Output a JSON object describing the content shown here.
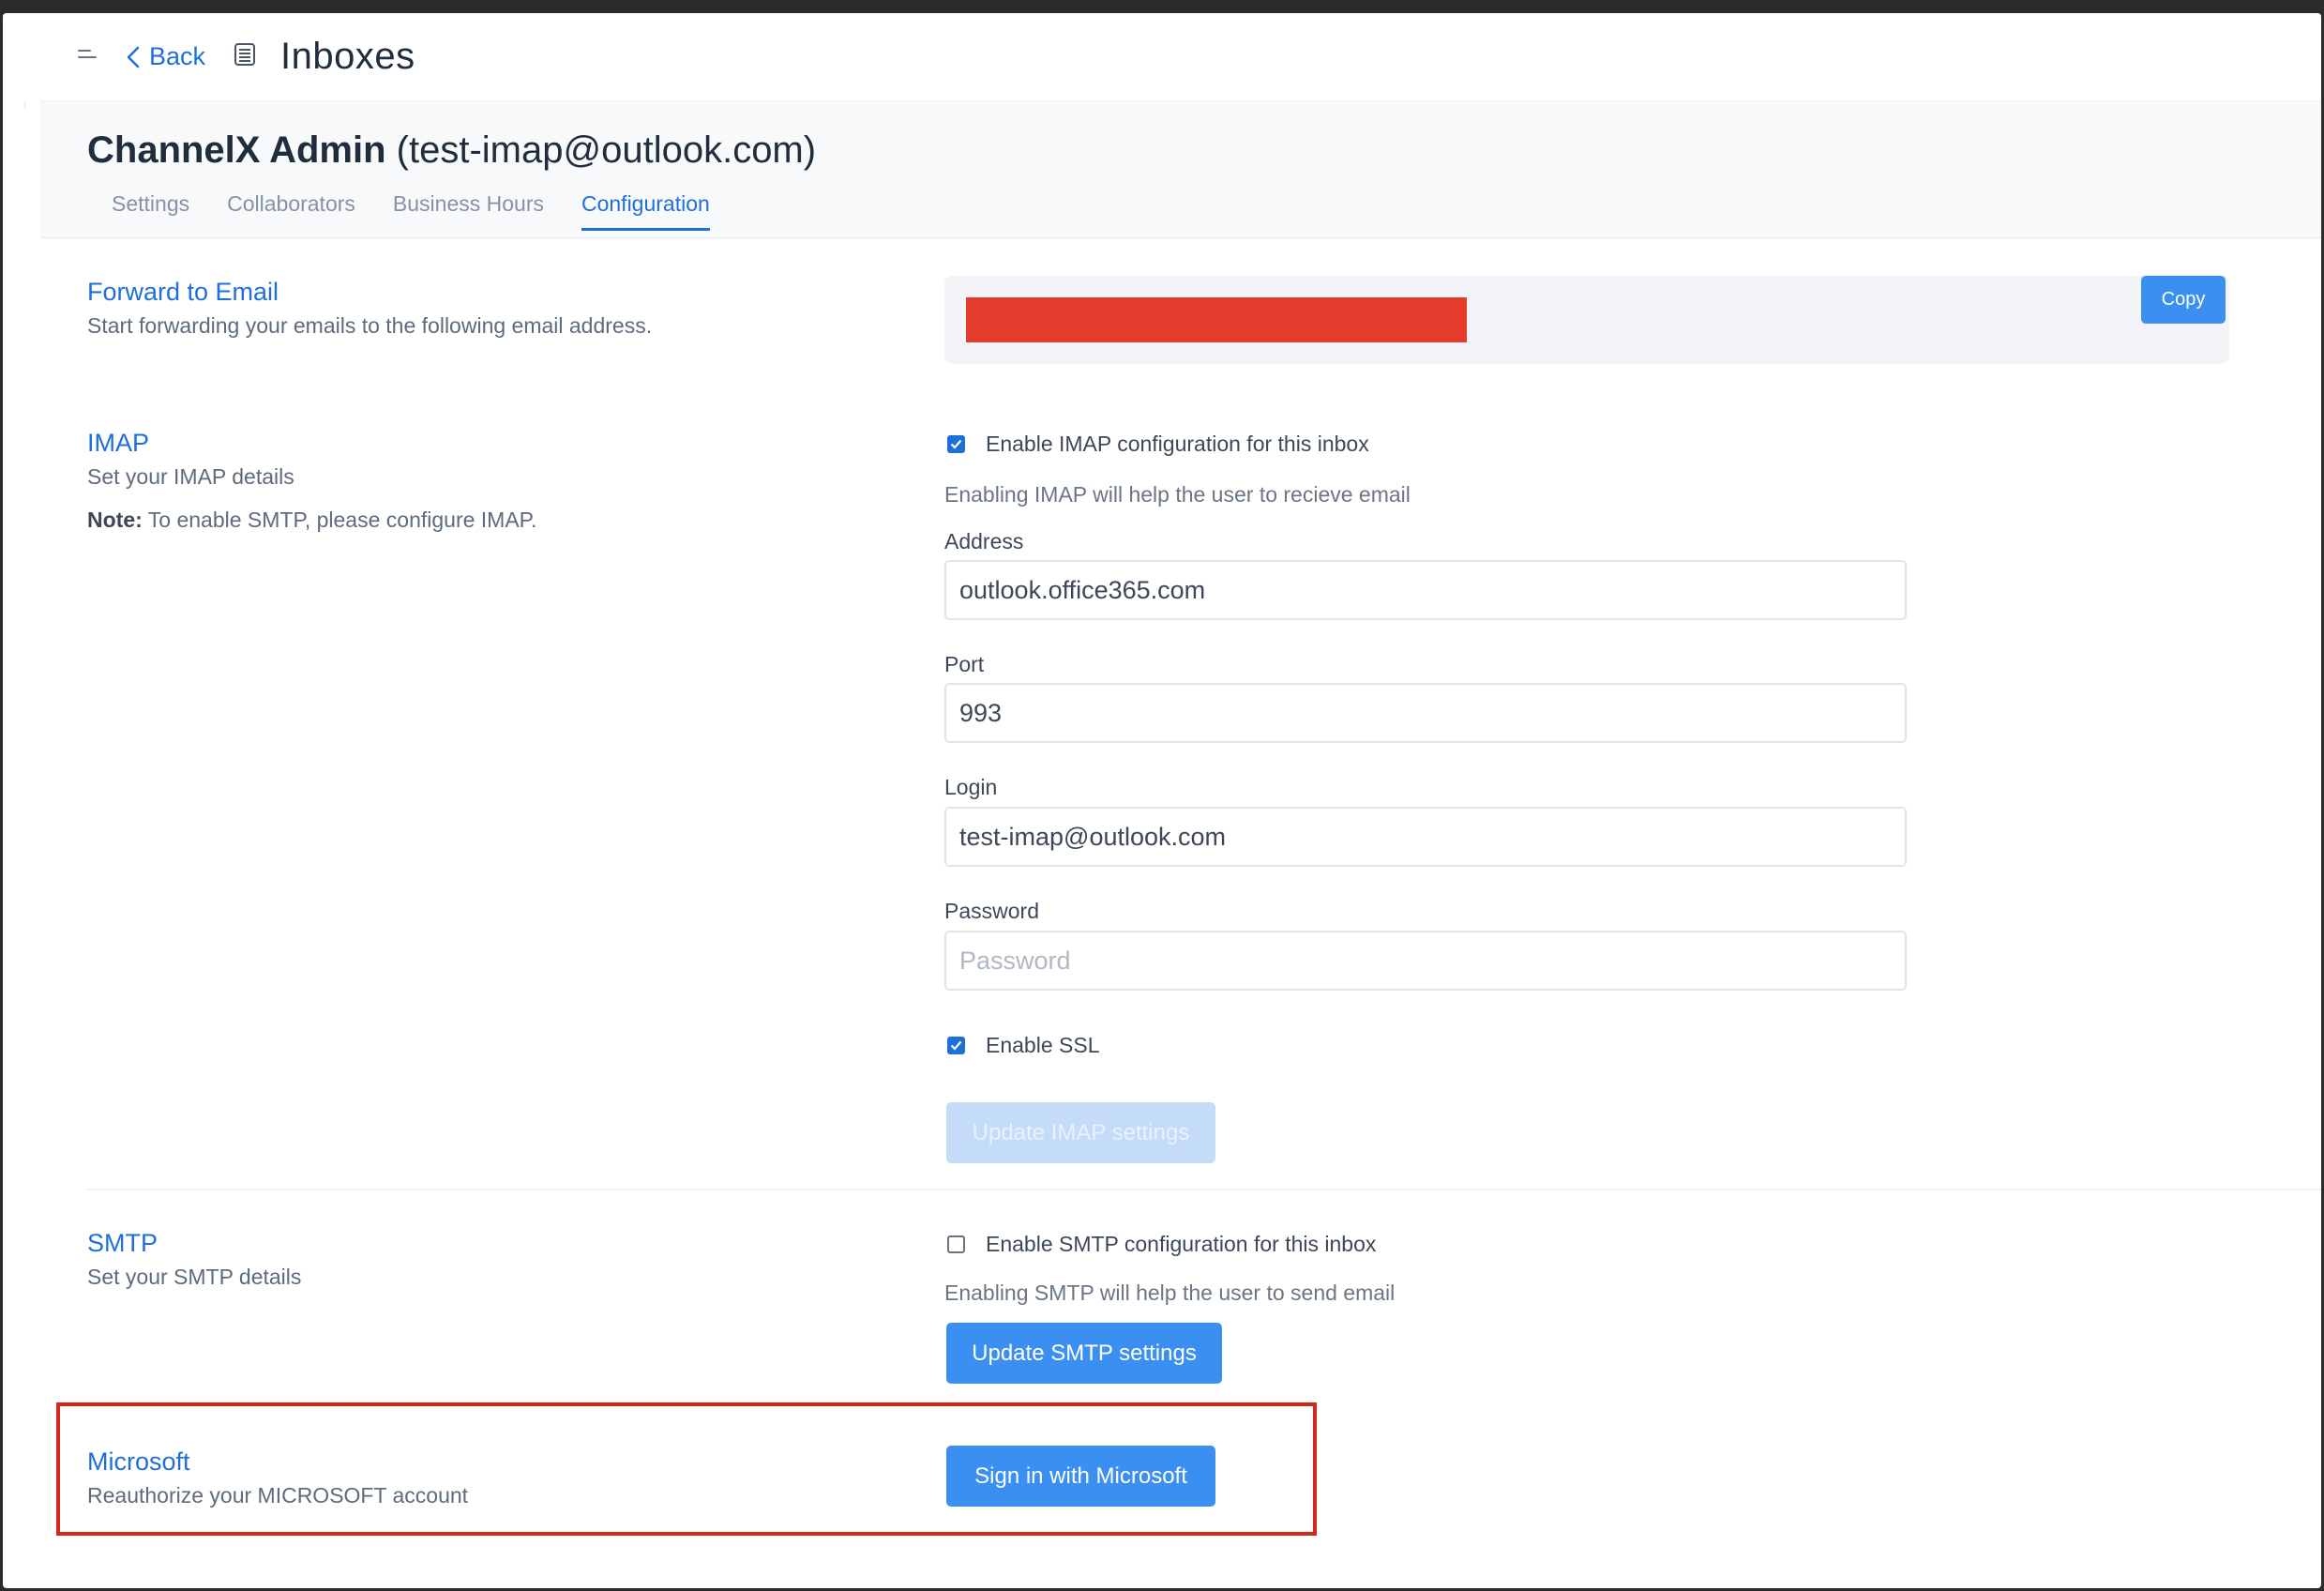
{
  "topbar": {
    "back_label": "Back",
    "title": "Inboxes"
  },
  "header": {
    "inbox_name": "ChannelX Admin",
    "inbox_email": "(test-imap@outlook.com)",
    "tabs": [
      {
        "label": "Settings",
        "active": false
      },
      {
        "label": "Collaborators",
        "active": false
      },
      {
        "label": "Business Hours",
        "active": false
      },
      {
        "label": "Configuration",
        "active": true
      }
    ]
  },
  "forward": {
    "title": "Forward to Email",
    "subtitle": "Start forwarding your emails to the following email address.",
    "copy_label": "Copy"
  },
  "imap": {
    "title": "IMAP",
    "subtitle": "Set your IMAP details",
    "note_label": "Note:",
    "note_text": "To enable SMTP, please configure IMAP.",
    "enable_label": "Enable IMAP configuration for this inbox",
    "enable_checked": true,
    "hint": "Enabling IMAP will help the user to recieve email",
    "address_label": "Address",
    "address_value": "outlook.office365.com",
    "port_label": "Port",
    "port_value": "993",
    "login_label": "Login",
    "login_value": "test-imap@outlook.com",
    "password_label": "Password",
    "password_placeholder": "Password",
    "ssl_label": "Enable SSL",
    "ssl_checked": true,
    "update_label": "Update IMAP settings"
  },
  "smtp": {
    "title": "SMTP",
    "subtitle": "Set your SMTP details",
    "enable_label": "Enable SMTP configuration for this inbox",
    "enable_checked": false,
    "hint": "Enabling SMTP will help the user to send email",
    "update_label": "Update SMTP settings"
  },
  "microsoft": {
    "title": "Microsoft",
    "subtitle": "Reauthorize your MICROSOFT account",
    "signin_label": "Sign in with Microsoft"
  },
  "colors": {
    "accent": "#1f6fda",
    "button": "#3b8ff0",
    "redaction": "#e53b2c",
    "highlight_border": "#d5261c"
  }
}
